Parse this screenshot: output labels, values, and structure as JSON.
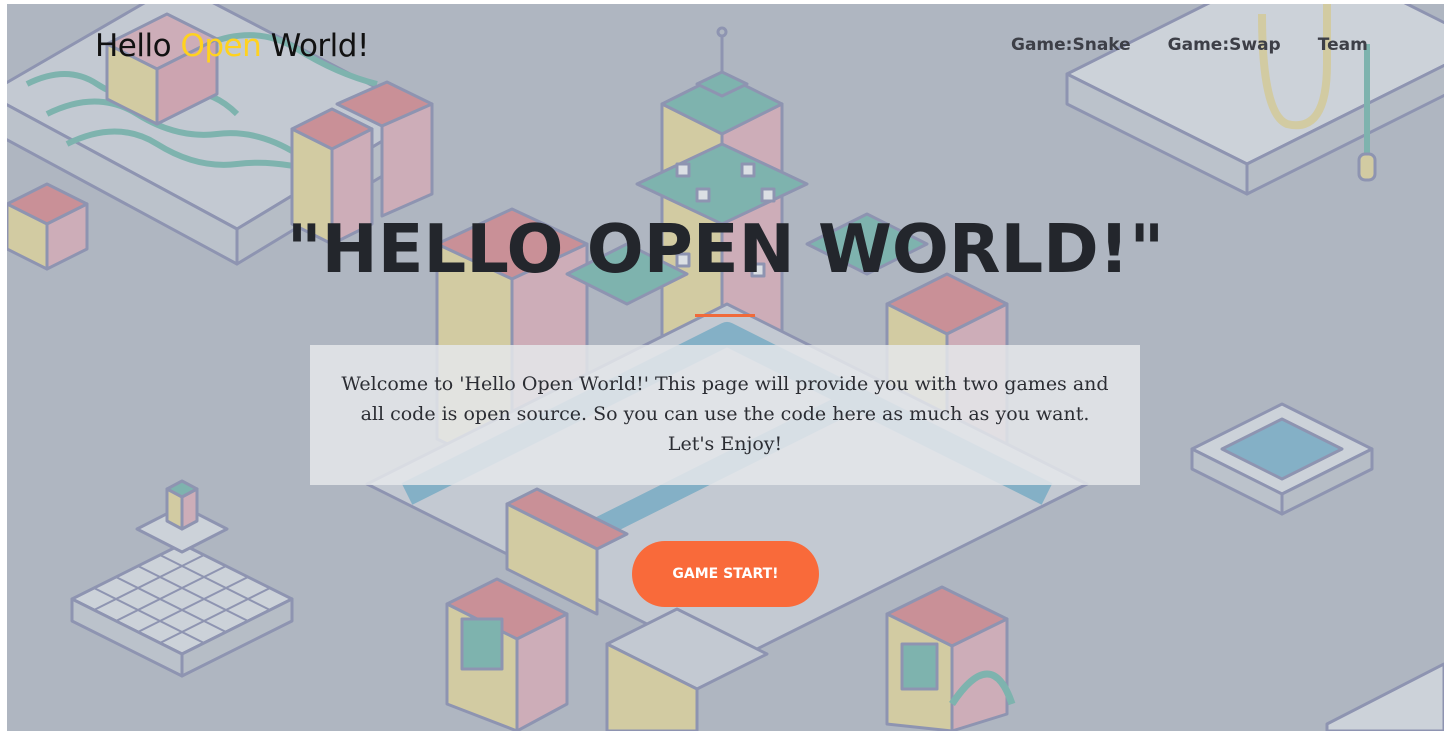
{
  "brand": {
    "part1": "Hello ",
    "part2": "Open",
    "part3": " World!"
  },
  "nav": {
    "items": [
      {
        "label": "Game:Snake"
      },
      {
        "label": "Game:Swap"
      },
      {
        "label": "Team"
      }
    ]
  },
  "hero": {
    "headline": "\"HELLO OPEN WORLD!\"",
    "intro": "Welcome to 'Hello Open World!' This page will provide you with two games and all code is open source. So you can use the code here as much as you want. Let's Enjoy!",
    "cta_label": "GAME START!"
  },
  "colors": {
    "brand_accent": "#ffd21f",
    "cta_background": "#f96a3a",
    "divider": "#f06a3a",
    "headline": "#23262c"
  }
}
